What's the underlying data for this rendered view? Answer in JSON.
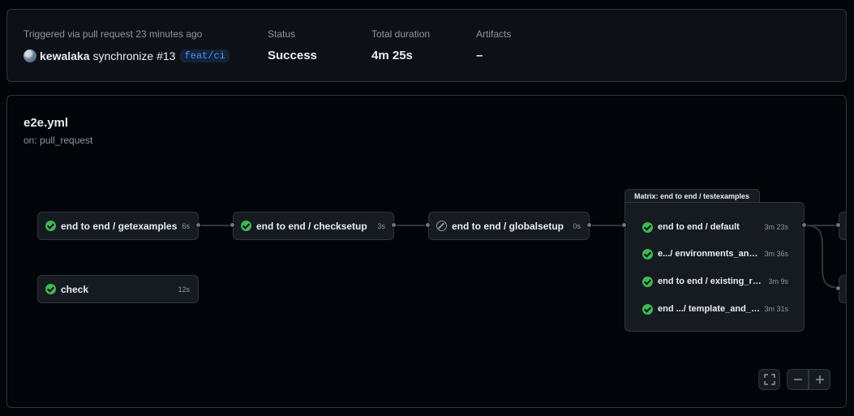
{
  "summary": {
    "trigger_label": "Triggered via pull request 23 minutes ago",
    "actor": "kewalaka",
    "event_text": "synchronize #13",
    "branch": "feat/ci",
    "status_label": "Status",
    "status_value": "Success",
    "duration_label": "Total duration",
    "duration_value": "4m 25s",
    "artifacts_label": "Artifacts",
    "artifacts_value": "–"
  },
  "workflow": {
    "file": "e2e.yml",
    "trigger": "on: pull_request"
  },
  "jobs": [
    {
      "name": "end to end / getexamples",
      "duration": "6s",
      "status": "success"
    },
    {
      "name": "end to end / checksetup",
      "duration": "3s",
      "status": "success"
    },
    {
      "name": "end to end / globalsetup",
      "duration": "0s",
      "status": "skipped"
    },
    {
      "name": "check",
      "duration": "12s",
      "status": "success"
    }
  ],
  "matrix": {
    "title": "Matrix: end to end / testexamples",
    "items": [
      {
        "name": "end to end / default",
        "duration": "3m 23s",
        "status": "success"
      },
      {
        "name": "e.../ environments_and_...",
        "duration": "3m 36s",
        "status": "success"
      },
      {
        "name": "end to end / existing_repo",
        "duration": "3m 9s",
        "status": "success"
      },
      {
        "name": "end .../ template_and_files",
        "duration": "3m 31s",
        "status": "success"
      }
    ]
  },
  "colors": {
    "success": "#3fb950",
    "branch_accent": "#4493f8",
    "border": "#30363d"
  }
}
